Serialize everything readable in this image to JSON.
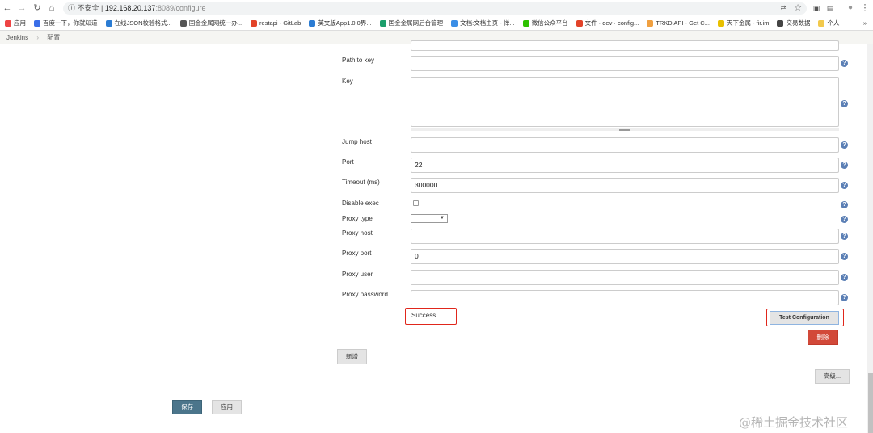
{
  "browser": {
    "url_security": "不安全",
    "url_host": "192.168.20.137",
    "url_path": ":8089/configure",
    "bookmarks": [
      {
        "label": "应用",
        "color": "#e44"
      },
      {
        "label": "百度一下，你就知道",
        "color": "#3a6ee8"
      },
      {
        "label": "在线JSON校验格式...",
        "color": "#2b7cd3"
      },
      {
        "label": "国金金属网统一办...",
        "color": "#555"
      },
      {
        "label": "restapi · GitLab",
        "color": "#e24329"
      },
      {
        "label": "英文版App1.0.0界...",
        "color": "#2b7cd3"
      },
      {
        "label": "国金金属网后台管理",
        "color": "#1b9e6b"
      },
      {
        "label": "文档:文档主页 - 禅...",
        "color": "#3a8ee6"
      },
      {
        "label": "微信公众平台",
        "color": "#2dc100"
      },
      {
        "label": "文件 · dev · config...",
        "color": "#e24329"
      },
      {
        "label": "TRKD API - Get C...",
        "color": "#f0a040"
      },
      {
        "label": "天下金属 - fir.im",
        "color": "#e8c000"
      },
      {
        "label": "交易数据",
        "color": "#444"
      },
      {
        "label": "个人",
        "color": "#f2c94c"
      }
    ],
    "more": "»"
  },
  "breadcrumb": {
    "root": "Jenkins",
    "sep": "›",
    "current": "配置"
  },
  "form": {
    "path_to_key": {
      "label": "Path to key",
      "value": ""
    },
    "key": {
      "label": "Key",
      "value": ""
    },
    "jump_host": {
      "label": "Jump host",
      "value": ""
    },
    "port": {
      "label": "Port",
      "value": "22"
    },
    "timeout": {
      "label": "Timeout (ms)",
      "value": "300000"
    },
    "disable_exec": {
      "label": "Disable exec",
      "checked": false
    },
    "proxy_type": {
      "label": "Proxy type",
      "value": ""
    },
    "proxy_host": {
      "label": "Proxy host",
      "value": ""
    },
    "proxy_port": {
      "label": "Proxy port",
      "value": "0"
    },
    "proxy_user": {
      "label": "Proxy user",
      "value": ""
    },
    "proxy_password": {
      "label": "Proxy password",
      "value": ""
    },
    "result": "Success",
    "test_button": "Test Configuration",
    "delete_button": "删除",
    "add_button": "新增",
    "advanced_button": "高级...",
    "save_button": "保存",
    "apply_button": "应用",
    "help_glyph": "?"
  },
  "colors": {
    "highlight": "#e0261b",
    "delete": "#d24939",
    "save": "#4b758b"
  },
  "watermark": "@稀土掘金技术社区"
}
